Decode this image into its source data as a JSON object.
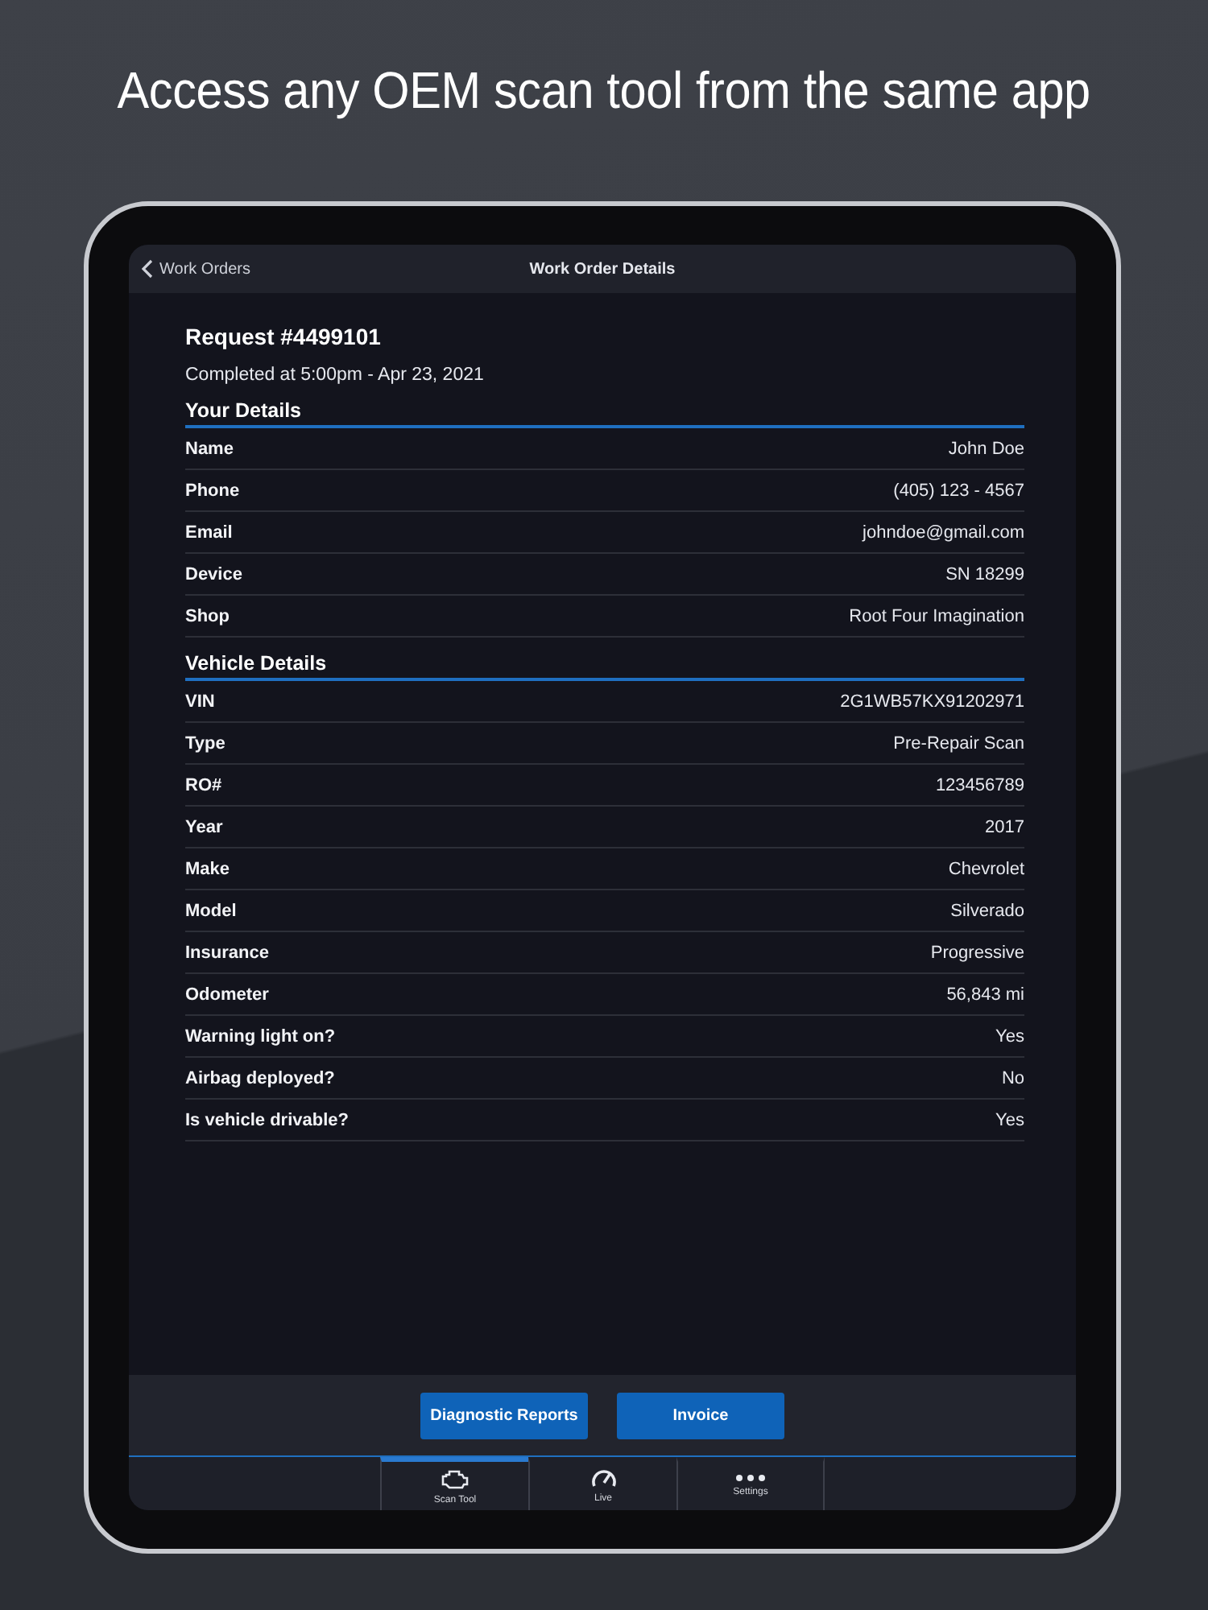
{
  "headline": "Access any OEM scan tool from the same app",
  "nav": {
    "back": "Work Orders",
    "title": "Work Order Details"
  },
  "request": {
    "title": "Request #4499101",
    "status": "Completed at 5:00pm - Apr 23, 2021"
  },
  "sections": [
    {
      "title": "Your Details",
      "rows": [
        {
          "label": "Name",
          "value": "John Doe"
        },
        {
          "label": "Phone",
          "value": "(405) 123 - 4567"
        },
        {
          "label": "Email",
          "value": "johndoe@gmail.com"
        },
        {
          "label": "Device",
          "value": "SN 18299"
        },
        {
          "label": "Shop",
          "value": "Root Four Imagination"
        }
      ]
    },
    {
      "title": "Vehicle Details",
      "rows": [
        {
          "label": "VIN",
          "value": "2G1WB57KX91202971"
        },
        {
          "label": "Type",
          "value": "Pre-Repair Scan"
        },
        {
          "label": "RO#",
          "value": "123456789"
        },
        {
          "label": "Year",
          "value": "2017"
        },
        {
          "label": "Make",
          "value": "Chevrolet"
        },
        {
          "label": "Model",
          "value": "Silverado"
        },
        {
          "label": "Insurance",
          "value": "Progressive"
        },
        {
          "label": "Odometer",
          "value": "56,843 mi"
        },
        {
          "label": "Warning light on?",
          "value": "Yes"
        },
        {
          "label": "Airbag deployed?",
          "value": "No"
        },
        {
          "label": "Is vehicle drivable?",
          "value": "Yes"
        }
      ]
    }
  ],
  "buttons": [
    "Diagnostic Reports",
    "Invoice"
  ],
  "tabs": [
    {
      "kind": "engine",
      "label": "Scan Tool",
      "selected": true
    },
    {
      "kind": "gauge",
      "label": "Live",
      "selected": false
    },
    {
      "kind": "dots",
      "label": "Settings",
      "selected": false
    }
  ]
}
